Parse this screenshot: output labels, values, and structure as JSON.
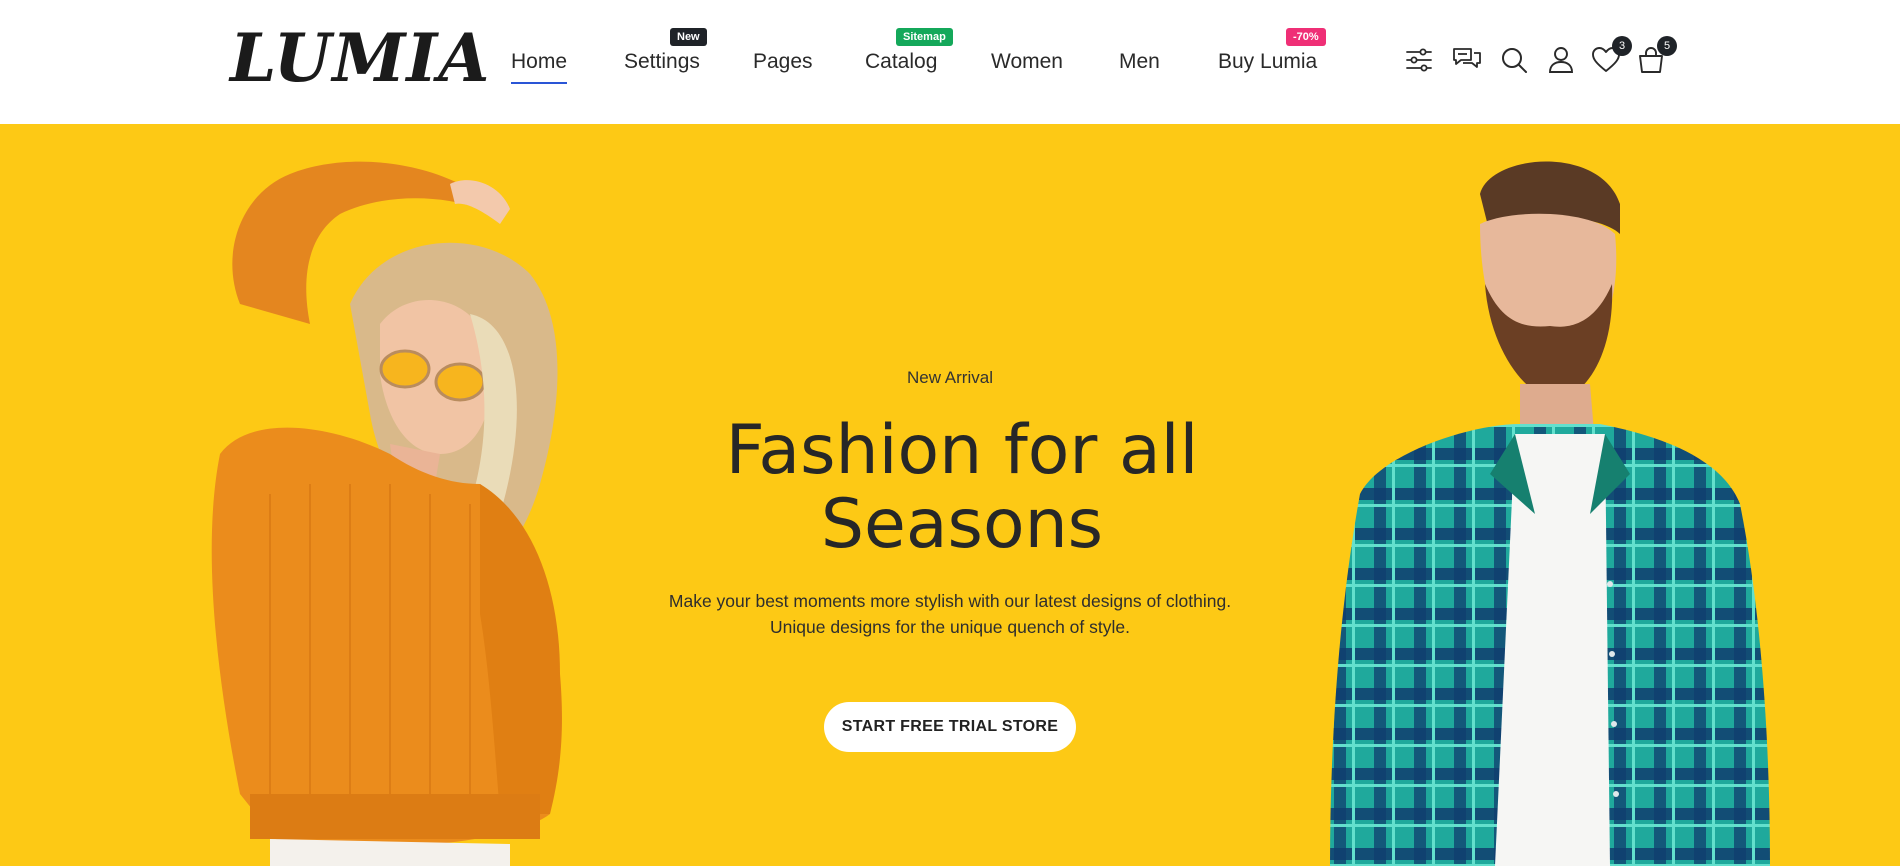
{
  "brand": {
    "logo_text": "LUMIA"
  },
  "nav": {
    "items": [
      {
        "label": "Home",
        "active": true
      },
      {
        "label": "Settings",
        "badge": "New",
        "badge_color": "#1f2328"
      },
      {
        "label": "Pages"
      },
      {
        "label": "Catalog",
        "badge": "Sitemap",
        "badge_color": "#14a85a"
      },
      {
        "label": "Women"
      },
      {
        "label": "Men"
      },
      {
        "label": "Buy Lumia",
        "badge": "-70%",
        "badge_color": "#ef2f76"
      }
    ]
  },
  "header_icons": {
    "filters": "sliders-icon",
    "chat": "chat-bubbles-icon",
    "search": "search-icon",
    "account": "user-icon",
    "wishlist": {
      "icon": "heart-icon",
      "count": "3"
    },
    "cart": {
      "icon": "shopping-bag-icon",
      "count": "5"
    }
  },
  "hero": {
    "eyebrow": "New Arrival",
    "headline_line1": "Fashion for all",
    "headline_line2": "Seasons",
    "subtext_line1": "Make your best moments more stylish with our latest designs of clothing.",
    "subtext_line2": "Unique designs for the unique quench of style.",
    "cta_label": "START FREE TRIAL STORE",
    "background_color": "#fdc915",
    "left_image": "woman-orange-sweater-photo",
    "right_image": "man-plaid-shirt-photo"
  },
  "colors": {
    "accent": "#2a55d6",
    "text_dark": "#222222",
    "badge_dark": "#1f2328",
    "badge_green": "#14a85a",
    "badge_pink": "#ef2f76"
  }
}
